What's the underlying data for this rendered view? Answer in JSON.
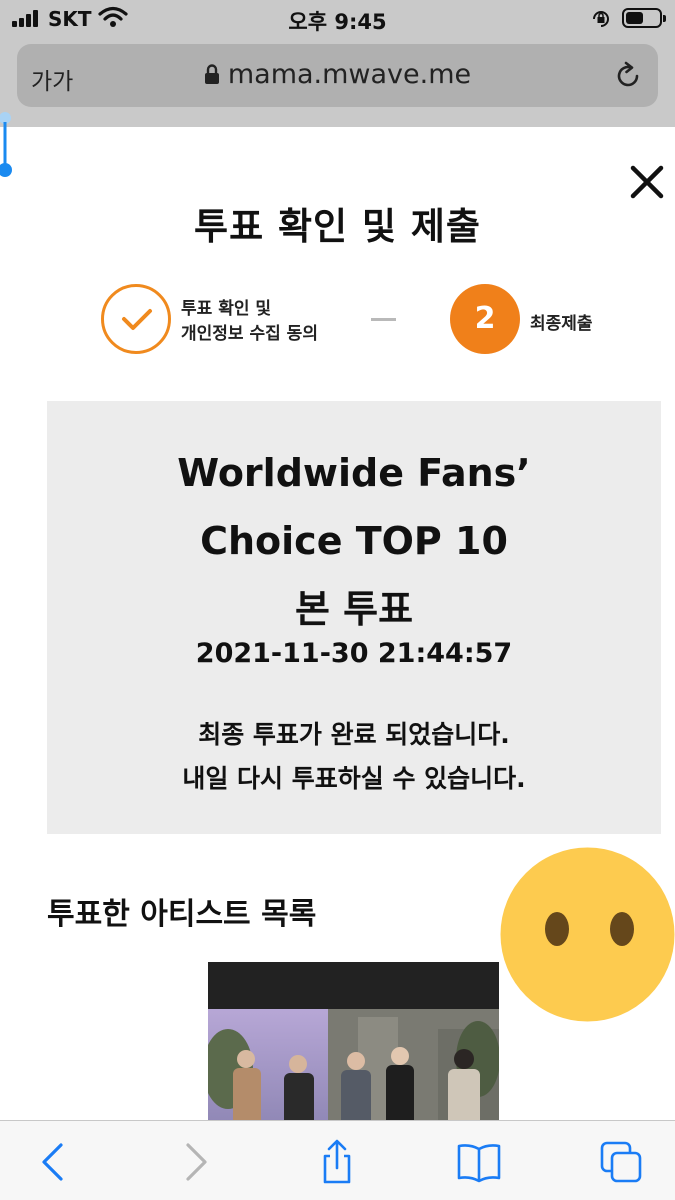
{
  "status_bar": {
    "carrier": "SKT",
    "time": "오후 9:45",
    "icons": [
      "signal-icon",
      "wifi-icon",
      "orientation-lock-icon",
      "battery-icon"
    ]
  },
  "browser": {
    "reader_label": "가가",
    "url": "mama.mwave.me",
    "icons": [
      "lock-icon",
      "reload-icon"
    ]
  },
  "modal": {
    "title": "투표 확인 및 제출",
    "steps": [
      {
        "number": "",
        "state": "done",
        "label_line1": "투표 확인 및",
        "label_line2": "개인정보 수집 동의"
      },
      {
        "number": "2",
        "state": "active",
        "label": "최종제출"
      }
    ],
    "accent_color": "#f0801a"
  },
  "summary": {
    "title_line1": "Worldwide Fans’",
    "title_line2": "Choice TOP 10",
    "title_line3": "본 투표",
    "timestamp": "2021-11-30 21:44:57",
    "message_line1": "최종 투표가 완료 되었습니다.",
    "message_line2": "내일 다시 투표하실 수 있습니다."
  },
  "artists": {
    "heading": "투표한 아티스트 목록"
  },
  "toolbar": {
    "icons": [
      "back-icon",
      "forward-icon",
      "share-icon",
      "bookmarks-icon",
      "tabs-icon"
    ]
  }
}
